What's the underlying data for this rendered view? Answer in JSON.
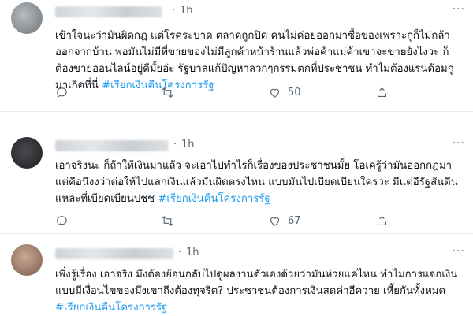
{
  "tweets": [
    {
      "time": "1h",
      "text": "เข้าใจนะว่ามันผิดกฎ แต่โรคระบาด ตลาดถูกปิด คนไม่ค่อยออกมาซื้อของเพราะกูก็ไม่กล้าออกจากบ้าน พอมันไม่มีที่ขายของไม่มีลูกค้าหน้าร้านแล้วพ่อค้าแม่ค้าเขาจะขายยังไงวะ ก็ต้องขายออนไลน์อยู่ดีมั้ยอ่ะ รัฐบาลแก้ปัญหาลวกๆกรรมตกที่ประชาชน ทำไมต้องแรนด้อมกูมาเกิดที่นี่",
      "hashtag": "#เรียกเงินคืนโครงการรัฐ",
      "likes": "50",
      "avatar_color": "#8a8f94"
    },
    {
      "time": "1h",
      "text": "เอาจริงนะ ก็ถ้าให้เงินมาแล้ว จะเอาไปทำไรก็เรื่องของประชาชนมั้ย โอเครู้ว่ามันออกกฎมา แต่คือนึงงว่าต่อให้ไปแลกเงินแล้วมันผิดตรงไหน แบบมันไปเบียดเบียนใครวะ มีแต่อีรัฐสันดีนแหละที่เบียดเบียนปชช",
      "hashtag": "#เรียกเงินคืนโครงการรัฐ",
      "likes": "67",
      "avatar_color": "#2f2f33"
    },
    {
      "time": "1h",
      "text": "เพิ่งรู้เรื่อง เอาจริง มึงต้องย้อนกลับไปดูผลงานตัวเองด้วยว่ามันห่วยแค่ไหน ทำไมการแจกเงินแบบมีเงื่อนไขของมึงเขาถึงต้องทุจริต? ประชาชนต้องการเงินสดค่าอีควาย เหี้ยกันทั้งหมด",
      "hashtag": "#เรียกเงินคืนโครงการรัฐ",
      "avatar_color": "#9b7a6a"
    }
  ],
  "colors": {
    "accent": "#1d9bf0",
    "muted": "#536471"
  },
  "icons": [
    "reply-icon",
    "retweet-icon",
    "like-icon",
    "share-icon",
    "more-icon"
  ]
}
